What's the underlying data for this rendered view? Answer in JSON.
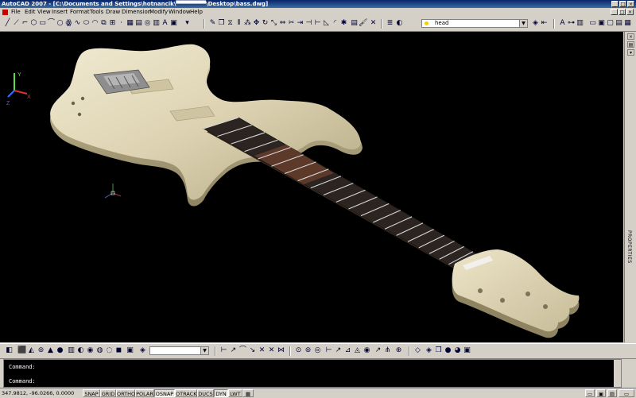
{
  "window": {
    "title": "AutoCAD 2007 - [C:\\Documents and Settings\\hotnancik\\▀▀▀▀▀▀▀\\Desktop\\bass.dwg]",
    "controls": [
      "_",
      "□",
      "×"
    ]
  },
  "menu": {
    "items": [
      "File",
      "Edit",
      "View",
      "Insert",
      "Format",
      "Tools",
      "Draw",
      "Dimension",
      "Modify",
      "Window",
      "Help"
    ],
    "mdi_controls": [
      "_",
      "□",
      "×"
    ]
  },
  "layer": {
    "current": "head",
    "color": "#f2d200"
  },
  "viewport": {
    "background": "#000000",
    "ucs_axes": [
      "Y",
      "X",
      "Z"
    ]
  },
  "properties_palette": {
    "label": "PROPERTIES"
  },
  "command": {
    "lines": [
      "Command:",
      "Command:"
    ]
  },
  "status": {
    "coordinates": "347.9812, -96.0266, 0.0000",
    "toggles": [
      {
        "label": "SNAP",
        "on": false
      },
      {
        "label": "GRID",
        "on": false
      },
      {
        "label": "ORTHO",
        "on": false
      },
      {
        "label": "POLAR",
        "on": false
      },
      {
        "label": "OSNAP",
        "on": true
      },
      {
        "label": "OTRACK",
        "on": false
      },
      {
        "label": "DUCS",
        "on": false
      },
      {
        "label": "DYN",
        "on": true
      },
      {
        "label": "LWT",
        "on": false
      }
    ]
  },
  "colors": {
    "body": "#e5dcc0",
    "fretboard": "#2a2a2a",
    "frets": "#d8d8d8",
    "titlebar": "#0a246a"
  }
}
